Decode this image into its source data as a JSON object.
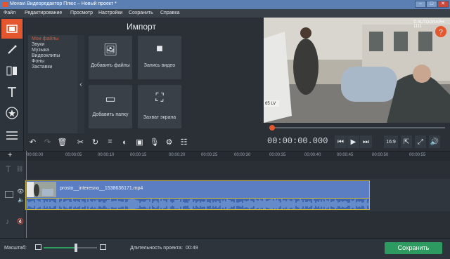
{
  "window": {
    "title": "Movavi Видеоредактор Плюс – Новый проект *",
    "controls": [
      "–",
      "□",
      "✕"
    ]
  },
  "menu": [
    "Файл",
    "Редактирование",
    "Просмотр",
    "Настройки",
    "Сохранить",
    "Справка"
  ],
  "sidebar": {
    "tools": [
      "film-icon",
      "magic-wand-icon",
      "transition-icon",
      "text-icon",
      "star-icon",
      "list-icon"
    ]
  },
  "import": {
    "title": "Импорт",
    "categories": [
      "Мои файлы",
      "Звуки",
      "Музыка",
      "Видеоклипы",
      "Фоны",
      "Заставки"
    ],
    "selected_category": "Мои файлы",
    "buttons": [
      {
        "label": "Добавить файлы",
        "icon": "add-media-icon"
      },
      {
        "label": "Запись видео",
        "icon": "camera-icon"
      },
      {
        "label": "Добавить папку",
        "icon": "folder-icon"
      },
      {
        "label": "Захват экрана",
        "icon": "screen-capture-icon"
      }
    ]
  },
  "preview": {
    "watermark": "© AUTOGRAPH 1111",
    "plate": "65 LV"
  },
  "player": {
    "timecode": "00:00:00.000",
    "aspect": "16:9"
  },
  "timeline": {
    "ticks": [
      "00:00:00",
      "00:00:05",
      "00:00:10",
      "00:00:15",
      "00:00:20",
      "00:00:25",
      "00:00:30",
      "00:00:35",
      "00:00:40",
      "00:00:45",
      "00:00:50",
      "00:00:55"
    ],
    "clip_name": "prosto__interesno__1538636171.mp4"
  },
  "footer": {
    "scale_label": "Масштаб:",
    "duration_label": "Длительность проекта:",
    "duration_value": "00:49",
    "save_label": "Сохранить",
    "zoom_level": 0.6
  },
  "colors": {
    "accent": "#e4572e",
    "save": "#2d9a5f",
    "clip": "#5b7ec2",
    "title_bar": "#5b7fb3"
  }
}
